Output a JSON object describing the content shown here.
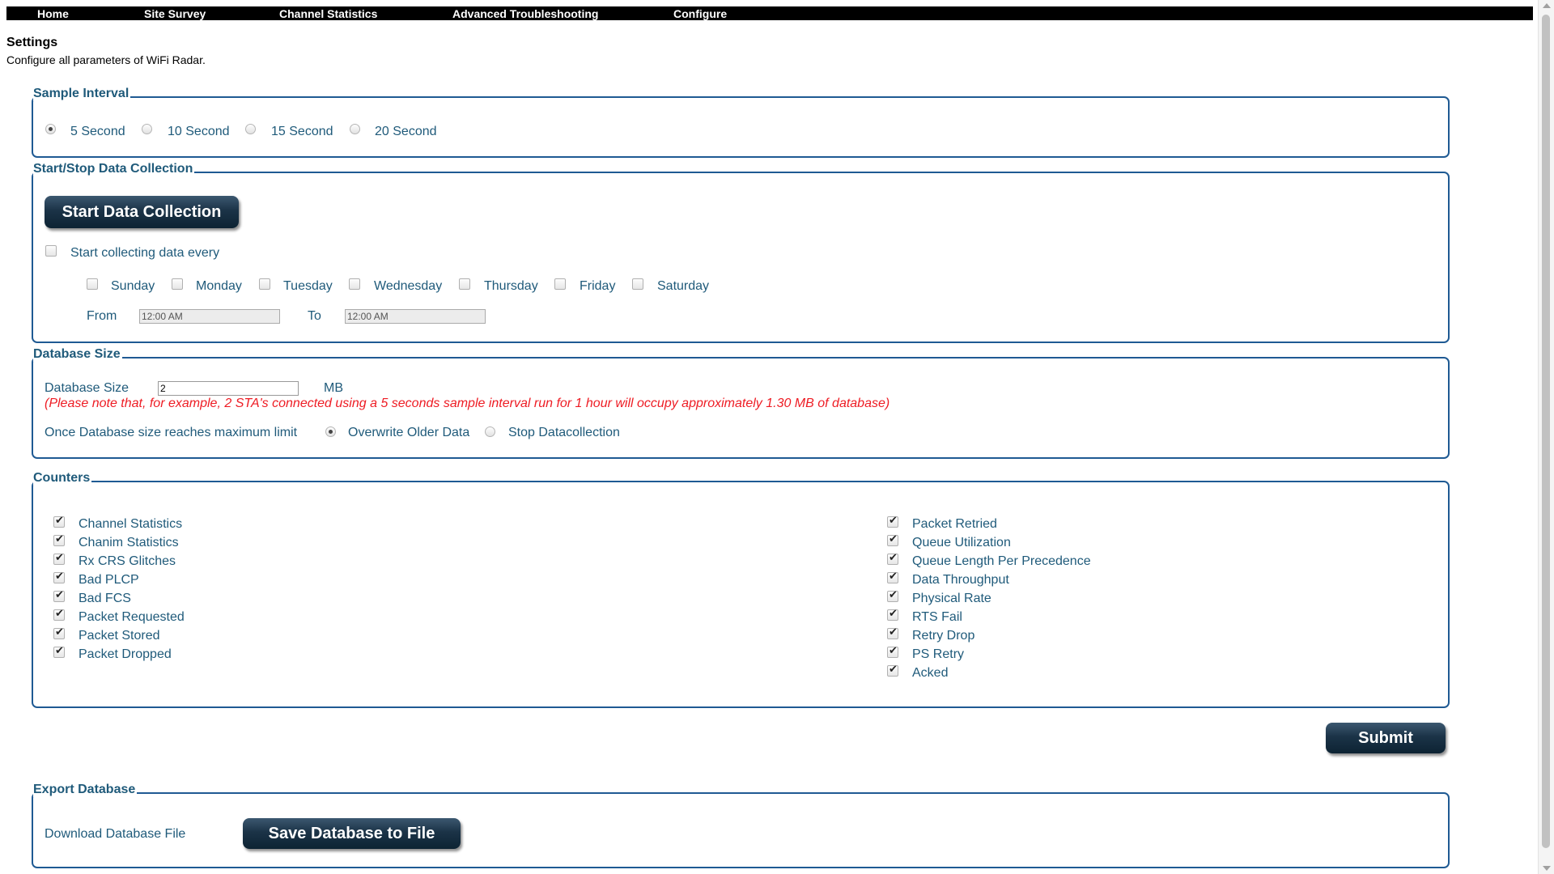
{
  "nav": {
    "items": [
      "Home",
      "Site Survey",
      "Channel Statistics",
      "Advanced Troubleshooting",
      "Configure"
    ]
  },
  "header": {
    "title": "Settings",
    "subtitle": "Configure all parameters of WiFi Radar."
  },
  "sample_interval": {
    "legend": "Sample Interval",
    "options": [
      "5 Second",
      "10 Second",
      "15 Second",
      "20 Second"
    ],
    "selected": "5 Second"
  },
  "collection": {
    "legend": "Start/Stop Data Collection",
    "start_button": "Start Data Collection",
    "schedule_label": "Start collecting data every",
    "schedule_checked": false,
    "days": [
      "Sunday",
      "Monday",
      "Tuesday",
      "Wednesday",
      "Thursday",
      "Friday",
      "Saturday"
    ],
    "from_label": "From",
    "from_value": "12:00 AM",
    "to_label": "To",
    "to_value": "12:00 AM"
  },
  "database": {
    "legend": "Database Size",
    "size_label": "Database Size",
    "size_value": "2",
    "unit": "MB",
    "note": "(Please note that, for example, 2 STA's connected using a 5 seconds sample interval run for 1 hour will occupy approximately 1.30 MB of database)",
    "limit_label": "Once Database size reaches maximum limit",
    "limit_options": [
      "Overwrite Older Data",
      "Stop Datacollection"
    ],
    "limit_selected": "Overwrite Older Data"
  },
  "counters": {
    "legend": "Counters",
    "left": [
      "Channel Statistics",
      "Chanim Statistics",
      "Rx CRS Glitches",
      "Bad PLCP",
      "Bad FCS",
      "Packet Requested",
      "Packet Stored",
      "Packet Dropped"
    ],
    "right": [
      "Packet Retried",
      "Queue Utilization",
      "Queue Length Per Precedence",
      "Data Throughput",
      "Physical Rate",
      "RTS Fail",
      "Retry Drop",
      "PS Retry",
      "Acked"
    ],
    "all_checked": true
  },
  "submit_label": "Submit",
  "export": {
    "legend": "Export Database",
    "download_label": "Download Database File",
    "save_button": "Save Database to File"
  },
  "colors": {
    "nav_bg": "#000000",
    "label_text": "#1f5a7a",
    "border": "#1f5a93",
    "note_red": "#ee1c24",
    "button_dark": "#1b3347"
  }
}
